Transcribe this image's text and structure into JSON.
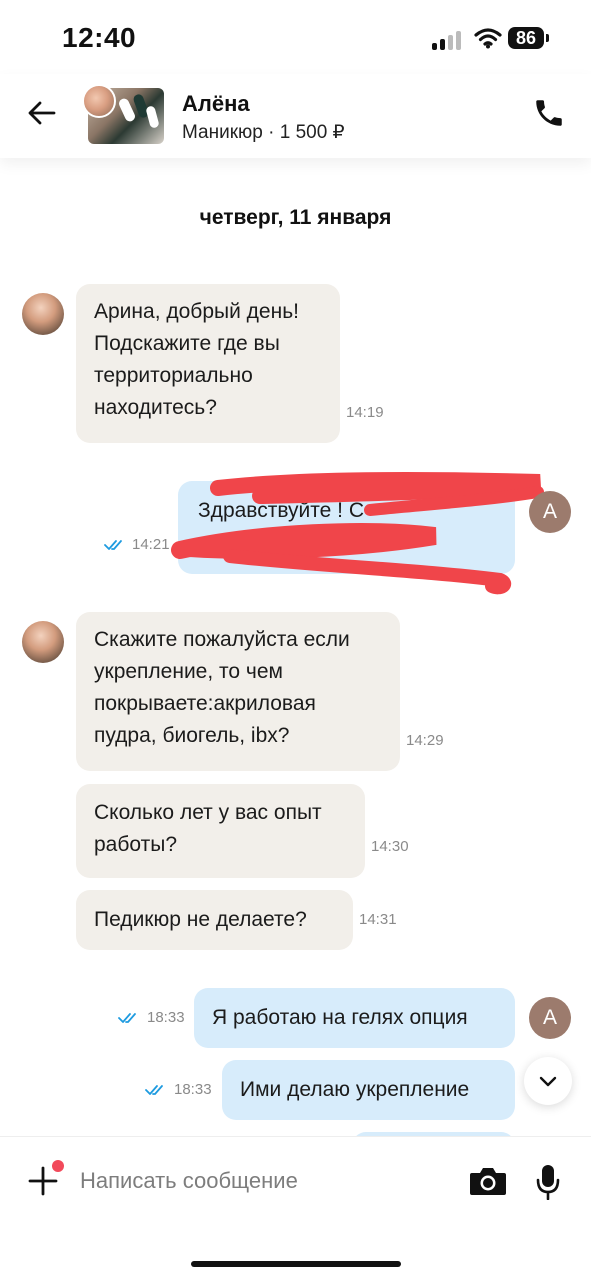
{
  "status": {
    "time": "12:40",
    "battery": "86"
  },
  "header": {
    "contact_name": "Алёна",
    "subtitle": "Маникюр · 1 500 ₽"
  },
  "day_label": "четверг, 11 января",
  "messages": [
    {
      "dir": "in",
      "lines": [
        "Арина, добрый день!",
        "Подскажите где вы",
        "территориально",
        "находитесь?"
      ],
      "time": "14:19"
    },
    {
      "dir": "out",
      "text": "Здравствуйте ! С",
      "time": "14:21",
      "read": true
    },
    {
      "dir": "in",
      "lines": [
        "Скажите пожалуйста если",
        "укрепление, то чем",
        "покрываете:акриловая",
        "пудра, биогель, ibx?"
      ],
      "time": "14:29"
    },
    {
      "dir": "in",
      "lines": [
        "Сколько лет у вас опыт",
        "работы?"
      ],
      "time": "14:30"
    },
    {
      "dir": "in",
      "lines": [
        "Педикюр не делаете?"
      ],
      "time": "14:31"
    },
    {
      "dir": "out",
      "text": "Я работаю на гелях опция",
      "time": "18:33",
      "read": true
    },
    {
      "dir": "out",
      "text": "Ими делаю укрепление",
      "time": "18:33",
      "read": true
    }
  ],
  "out_avatar_letter": "А",
  "composer": {
    "placeholder": "Написать сообщение"
  },
  "colors": {
    "incoming": "#f2efea",
    "outgoing": "#d7ecfb",
    "read_ticks": "#1e9be0",
    "scribble": "#f0454a",
    "notification_dot": "#f24a5b"
  },
  "icons": [
    "back-arrow-icon",
    "phone-icon",
    "read-ticks-icon",
    "chevron-down-icon",
    "plus-icon",
    "camera-icon",
    "microphone-icon"
  ]
}
